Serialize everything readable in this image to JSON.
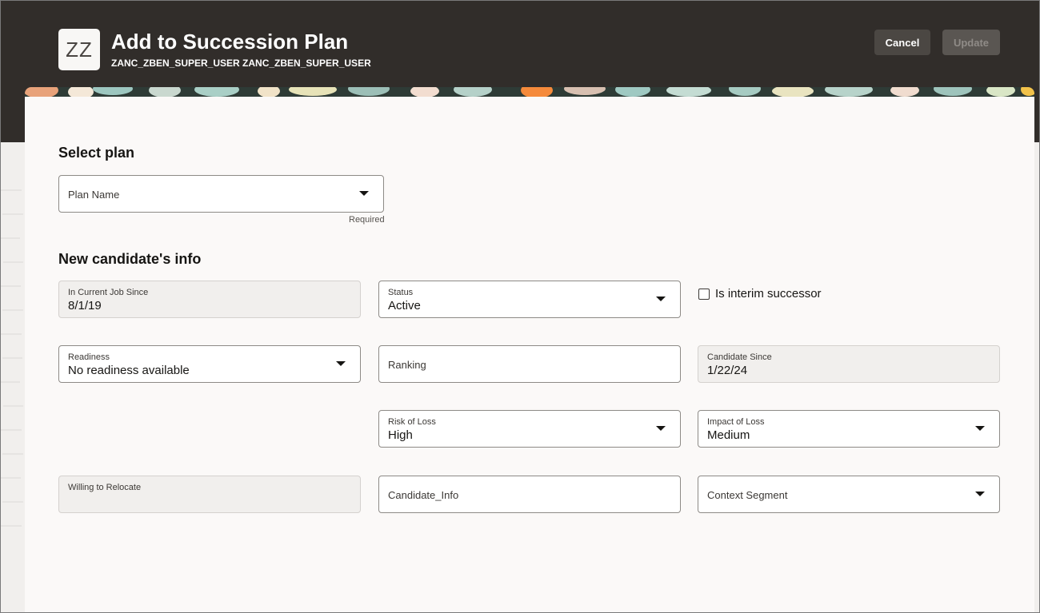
{
  "header": {
    "avatar_initials": "ZZ",
    "title": "Add to Succession Plan",
    "subtitle": "ZANC_ZBEN_SUPER_USER ZANC_ZBEN_SUPER_USER",
    "cancel_label": "Cancel",
    "update_label": "Update"
  },
  "select_plan": {
    "title": "Select plan",
    "plan_name_label": "Plan Name",
    "required_text": "Required"
  },
  "candidate": {
    "title": "New candidate's info",
    "in_current_job_since_label": "In Current Job Since",
    "in_current_job_since_value": "8/1/19",
    "status_label": "Status",
    "status_value": "Active",
    "interim_label": "Is interim successor",
    "readiness_label": "Readiness",
    "readiness_value": "No readiness available",
    "ranking_label": "Ranking",
    "candidate_since_label": "Candidate Since",
    "candidate_since_value": "1/22/24",
    "risk_of_loss_label": "Risk of Loss",
    "risk_of_loss_value": "High",
    "impact_of_loss_label": "Impact of Loss",
    "impact_of_loss_value": "Medium",
    "willing_to_relocate_label": "Willing to Relocate",
    "candidate_info_label": "Candidate_Info",
    "context_segment_label": "Context Segment"
  },
  "colors": {
    "header_bg": "#312d2a",
    "card_bg": "#fbf9f8",
    "page_bg": "#f1efed"
  }
}
